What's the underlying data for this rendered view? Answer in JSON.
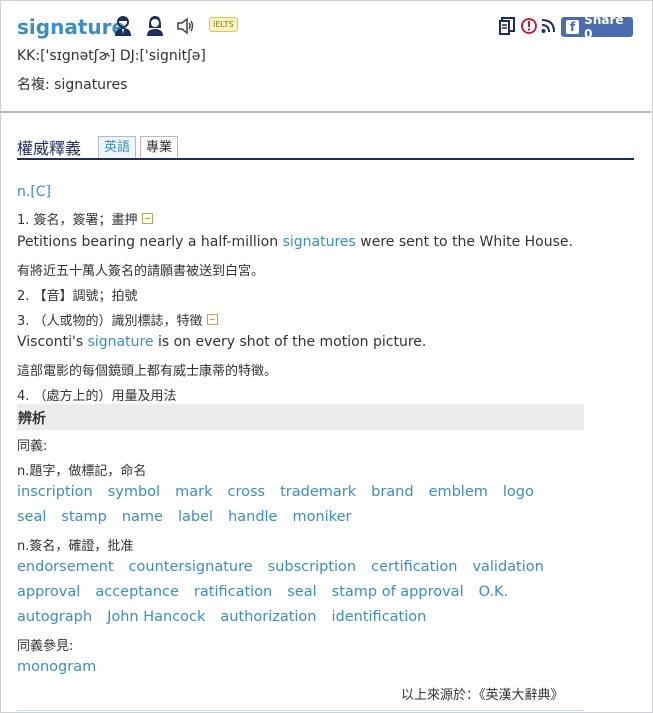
{
  "header": {
    "word": "signature",
    "ielts_badge": "IELTS",
    "phonetic": "KK:['sɪgnətʃɚ] DJ:['signitʃə]",
    "plural": "名複: signatures",
    "share_label": "Share 0"
  },
  "icons": [
    "male-voice-icon",
    "female-voice-icon",
    "speaker-icon",
    "wordlist-icon",
    "report-icon",
    "rss-icon",
    "facebook-icon"
  ],
  "tabs": {
    "section_title": "權威釋義",
    "items": [
      {
        "label": "英語",
        "active": true
      },
      {
        "label": "專業",
        "active": false
      }
    ]
  },
  "definition": {
    "pos": "n.[C]",
    "sense1": "1. 簽名，簽署；畫押",
    "ex1_pre": "Petitions bearing nearly a half-million ",
    "ex1_link": "signatures",
    "ex1_post": " were sent to the White House.",
    "ex1_zh": "有將近五十萬人簽名的請願書被送到白宮。",
    "sense2": "2. 【音】調號；拍號",
    "sense3": "3. （人或物的）識別標誌，特徵",
    "ex3_pre": "Visconti's ",
    "ex3_link": "signature",
    "ex3_post": " is on every shot of the motion picture.",
    "ex3_zh": "這部電影的每個鏡頭上都有威士康蒂的特徵。",
    "sense4": "4. （處方上的）用量及用法"
  },
  "analysis": {
    "title": "辨析",
    "synonyms_label": "同義:",
    "group1_label": "n.題字，做標記，命名",
    "group1_row1": [
      "inscription",
      "symbol",
      "mark",
      "cross",
      "trademark",
      "brand",
      "emblem",
      "logo"
    ],
    "group1_row2": [
      "seal",
      "stamp",
      "name",
      "label",
      "handle",
      "moniker"
    ],
    "group2_label": "n.簽名，確證，批准",
    "group2_row1": [
      "endorsement",
      "countersignature",
      "subscription",
      "certification",
      "validation"
    ],
    "group2_row2": [
      "approval",
      "acceptance",
      "ratification",
      "seal",
      "stamp of approval",
      "O.K."
    ],
    "group2_row3": [
      "autograph",
      "John Hancock",
      "authorization",
      "identification"
    ],
    "see_also_label": "同義參見:",
    "see_also": [
      "monogram"
    ],
    "source": "以上來源於：《英漢大辭典》"
  },
  "colors": {
    "link": "#3b8ec2",
    "navy": "#1d2d5c",
    "facebook": "#4a6db1"
  }
}
